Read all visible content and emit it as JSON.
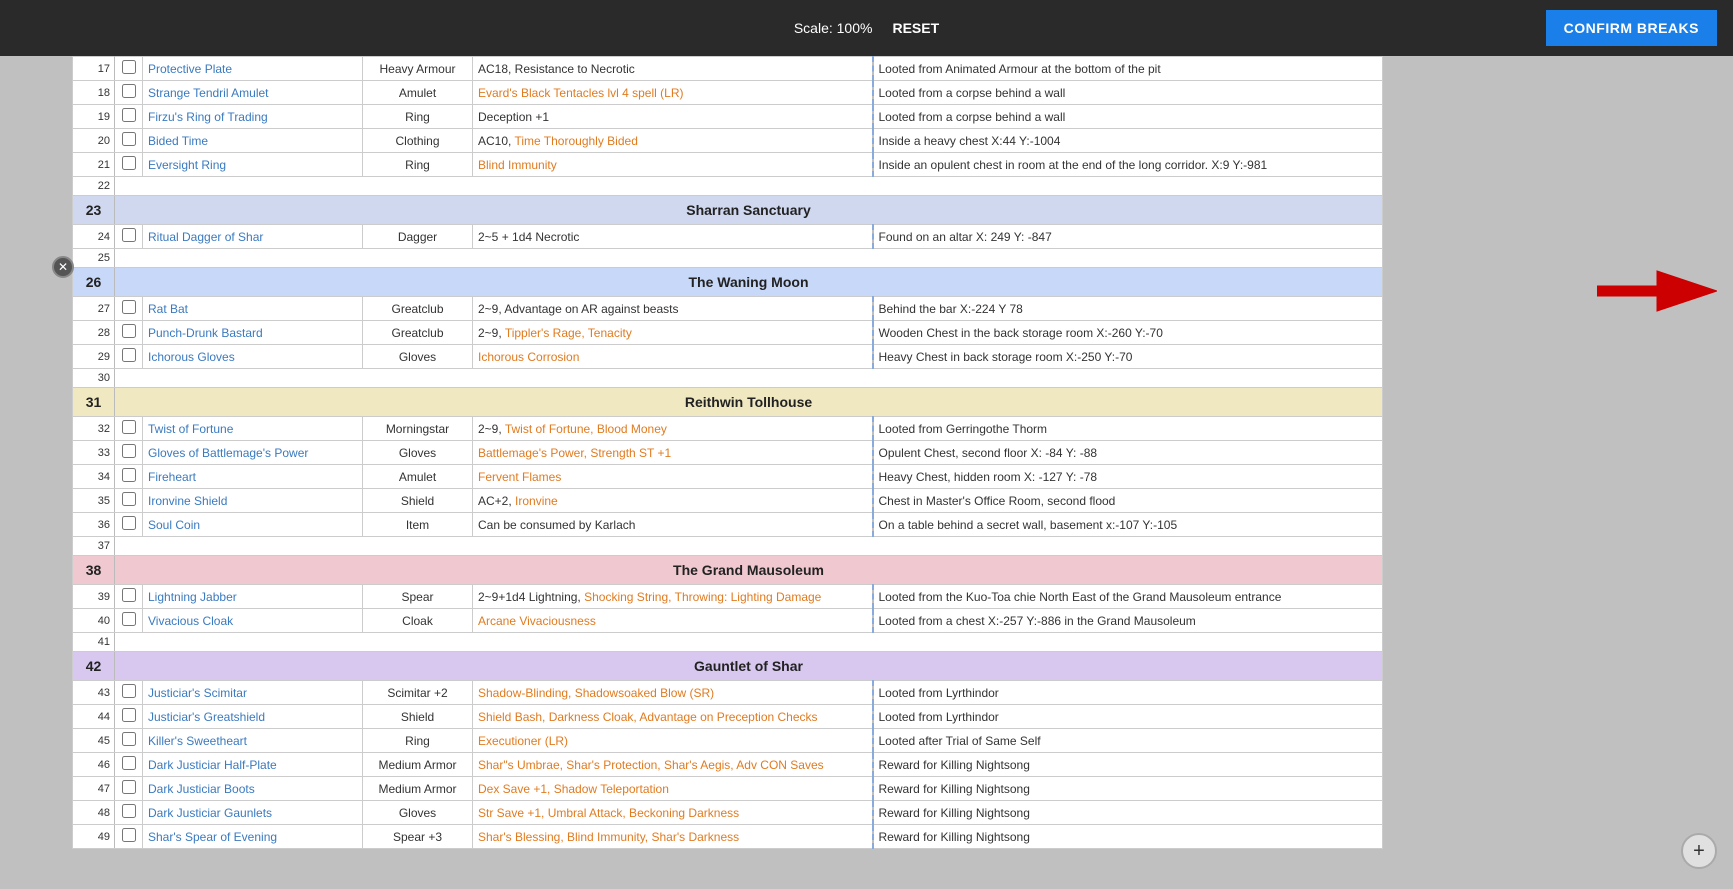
{
  "topbar": {
    "scale_label": "Scale: 100%",
    "reset_label": "RESET",
    "confirm_label": "CONFIRM BREAKS"
  },
  "rows": [
    {
      "num": 17,
      "checkable": true,
      "name": "Protective Plate",
      "type": "Heavy Armour",
      "props": "AC18, Resistance to Necrotic",
      "props_colored": false,
      "loc": "Looted from Animated Armour at the bottom of the pit"
    },
    {
      "num": 18,
      "checkable": true,
      "name": "Strange Tendril Amulet",
      "type": "Amulet",
      "props": "Evard's Black Tentacles lvl 4 spell (LR)",
      "props_colored": true,
      "loc": "Looted from a corpse behind a wall"
    },
    {
      "num": 19,
      "checkable": true,
      "name": "Firzu's Ring of Trading",
      "type": "Ring",
      "props": "Deception +1",
      "props_colored": false,
      "loc": "Looted from a corpse behind a wall"
    },
    {
      "num": 20,
      "checkable": true,
      "name": "Bided Time",
      "type": "Clothing",
      "props": "AC10, Time Thoroughly Bided",
      "props_colored": true,
      "loc": "Inside a heavy chest  X:44 Y:-1004"
    },
    {
      "num": 21,
      "checkable": true,
      "name": "Eversight Ring",
      "type": "Ring",
      "props": "Blind Immunity",
      "props_colored": true,
      "loc": "Inside an opulent chest in room at the end of the long corridor. X:9 Y:-981"
    },
    {
      "num": 22,
      "checkable": false,
      "name": "",
      "type": "",
      "props": "",
      "loc": ""
    },
    {
      "num": 23,
      "section": true,
      "section_class": "section-sharran",
      "label": "Sharran Sanctuary"
    },
    {
      "num": 24,
      "checkable": true,
      "name": "Ritual Dagger of Shar",
      "type": "Dagger",
      "props": "2~5 + 1d4 Necrotic",
      "props_colored": false,
      "loc": "Found on an altar X: 249 Y: -847"
    },
    {
      "num": 25,
      "checkable": false,
      "name": "",
      "type": "",
      "props": "",
      "loc": ""
    },
    {
      "num": 26,
      "section": true,
      "section_class": "section-waning",
      "label": "The Waning Moon"
    },
    {
      "num": 27,
      "checkable": true,
      "name": "Rat Bat",
      "type": "Greatclub",
      "props": "2~9, Advantage on AR against beasts",
      "props_colored": false,
      "loc": "Behind the bar X:-224 Y 78"
    },
    {
      "num": 28,
      "checkable": true,
      "name": "Punch-Drunk Bastard",
      "type": "Greatclub",
      "props": "2~9, Tippler's Rage, Tenacity",
      "props_colored": true,
      "loc": "Wooden Chest in the back storage room X:-260 Y:-70"
    },
    {
      "num": 29,
      "checkable": true,
      "name": "Ichorous Gloves",
      "type": "Gloves",
      "props": "Ichorous Corrosion",
      "props_colored": true,
      "loc": "Heavy Chest in back storage room X:-250 Y:-70"
    },
    {
      "num": 30,
      "checkable": false,
      "name": "",
      "type": "",
      "props": "",
      "loc": ""
    },
    {
      "num": 31,
      "section": true,
      "section_class": "section-reithwin",
      "label": "Reithwin Tollhouse"
    },
    {
      "num": 32,
      "checkable": true,
      "name": "Twist of Fortune",
      "type": "Morningstar",
      "props": "2~9, Twist of Fortune, Blood Money",
      "props_colored": true,
      "loc": "Looted from Gerringothe Thorm"
    },
    {
      "num": 33,
      "checkable": true,
      "name": "Gloves of Battlemage's Power",
      "type": "Gloves",
      "props": "Battlemage's Power, Strength ST +1",
      "props_colored": true,
      "loc": "Opulent Chest, second floor X: -84 Y: -88"
    },
    {
      "num": 34,
      "checkable": true,
      "name": "Fireheart",
      "type": "Amulet",
      "props": "Fervent Flames",
      "props_colored": true,
      "loc": "Heavy Chest, hidden room X: -127 Y: -78"
    },
    {
      "num": 35,
      "checkable": true,
      "name": "Ironvine Shield",
      "type": "Shield",
      "props": "AC+2, Ironvine",
      "props_colored": true,
      "loc": "Chest in Master's Office Room, second flood"
    },
    {
      "num": 36,
      "checkable": true,
      "name": "Soul Coin",
      "type": "Item",
      "props": "Can be consumed by Karlach",
      "props_colored": false,
      "loc": "On a table behind a secret wall, basement x:-107 Y:-105"
    },
    {
      "num": 37,
      "checkable": false,
      "name": "",
      "type": "",
      "props": "",
      "loc": ""
    },
    {
      "num": 38,
      "section": true,
      "section_class": "section-grand",
      "label": "The Grand Mausoleum"
    },
    {
      "num": 39,
      "checkable": true,
      "name": "Lightning Jabber",
      "type": "Spear",
      "props": "2~9+1d4 Lightning, Shocking String, Throwing: Lighting Damage",
      "props_colored": true,
      "loc": "Looted from the Kuo-Toa chie North East of the Grand Mausoleum entrance"
    },
    {
      "num": 40,
      "checkable": true,
      "name": "Vivacious Cloak",
      "type": "Cloak",
      "props": "Arcane Vivaciousness",
      "props_colored": true,
      "loc": "Looted from a chest X:-257 Y:-886 in the Grand Mausoleum"
    },
    {
      "num": 41,
      "checkable": false,
      "name": "",
      "type": "",
      "props": "",
      "loc": ""
    },
    {
      "num": 42,
      "section": true,
      "section_class": "section-gauntlet",
      "label": "Gauntlet of Shar"
    },
    {
      "num": 43,
      "checkable": true,
      "name": "Justiciar's Scimitar",
      "type": "Scimitar +2",
      "props": "Shadow-Blinding, Shadowsoaked Blow (SR)",
      "props_colored": true,
      "loc": "Looted from Lyrthindor"
    },
    {
      "num": 44,
      "checkable": true,
      "name": "Justiciar's Greatshield",
      "type": "Shield",
      "props": "Shield Bash, Darkness Cloak, Advantage on Preception Checks",
      "props_colored": true,
      "loc": "Looted from Lyrthindor"
    },
    {
      "num": 45,
      "checkable": true,
      "name": "Killer's Sweetheart",
      "type": "Ring",
      "props": "Executioner (LR)",
      "props_colored": true,
      "loc": "Looted after Trial of Same Self"
    },
    {
      "num": 46,
      "checkable": true,
      "name": "Dark Justiciar Half-Plate",
      "type": "Medium Armor",
      "props": "Shar\"s Umbrae, Shar's Protection, Shar's Aegis, Adv CON Saves",
      "props_colored": true,
      "loc": "Reward for Killing Nightsong"
    },
    {
      "num": 47,
      "checkable": true,
      "name": "Dark Justiciar Boots",
      "type": "Medium Armor",
      "props": "Dex Save +1, Shadow Teleportation",
      "props_colored": true,
      "loc": "Reward for Killing Nightsong"
    },
    {
      "num": 48,
      "checkable": true,
      "name": "Dark Justiciar Gaunlets",
      "type": "Gloves",
      "props": "Str Save +1, Umbral Attack, Beckoning Darkness",
      "props_colored": true,
      "loc": "Reward for Killing Nightsong"
    },
    {
      "num": 49,
      "checkable": true,
      "name": "Shar's Spear of Evening",
      "type": "Spear +3",
      "props": "Shar's Blessing, Blind Immunity, Shar's Darkness",
      "props_colored": true,
      "loc": "Reward for Killing Nightsong"
    }
  ],
  "close_icon": "✕",
  "plus_icon": "+"
}
